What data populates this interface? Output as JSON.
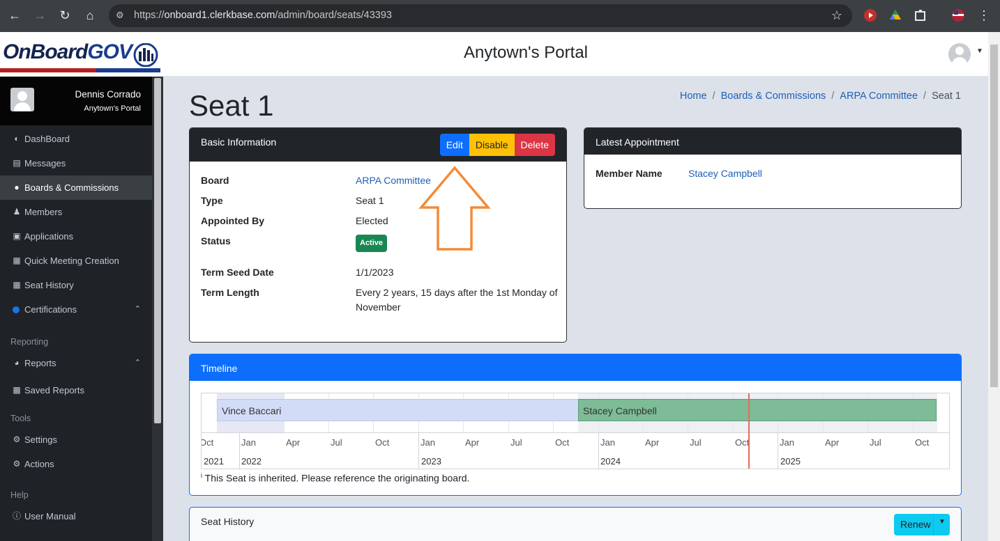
{
  "browser": {
    "url_prefix": "https://",
    "url_host": "onboard1.clerkbase.com",
    "url_path": "/admin/board/seats/43393"
  },
  "logo": {
    "text_main": "OnBoard",
    "text_accent": "GOV"
  },
  "user": {
    "name": "Dennis Corrado",
    "portal": "Anytown's Portal"
  },
  "sidebar": {
    "items": [
      {
        "label": "DashBoard",
        "icon": "tachometer-icon"
      },
      {
        "label": "Messages",
        "icon": "inbox-icon"
      },
      {
        "label": "Boards & Commissions",
        "icon": "users-icon",
        "active": true
      },
      {
        "label": "Members",
        "icon": "user-icon"
      },
      {
        "label": "Applications",
        "icon": "id-card-icon"
      },
      {
        "label": "Quick Meeting Creation",
        "icon": "calendar-plus-icon"
      },
      {
        "label": "Seat History",
        "icon": "calendar-icon"
      },
      {
        "label": "Certifications",
        "icon": "blue-dot-icon"
      }
    ],
    "reporting_header": "Reporting",
    "reporting_items": [
      {
        "label": "Reports",
        "icon": "pie-chart-icon"
      },
      {
        "label": "Saved Reports",
        "icon": "save-icon"
      }
    ],
    "tools_header": "Tools",
    "tools_items": [
      {
        "label": "Settings",
        "icon": "gear-icon"
      },
      {
        "label": "Actions",
        "icon": "gears-icon"
      }
    ],
    "help_header": "Help",
    "help_items": [
      {
        "label": "User Manual",
        "icon": "info-circle-icon"
      }
    ]
  },
  "header": {
    "portal_title": "Anytown's Portal"
  },
  "page": {
    "title": "Seat 1",
    "breadcrumb": [
      "Home",
      "Boards & Commissions",
      "ARPA Committee",
      "Seat 1"
    ]
  },
  "basic_info": {
    "title": "Basic Information",
    "buttons": {
      "edit": "Edit",
      "disable": "Disable",
      "delete": "Delete"
    },
    "rows": {
      "board_label": "Board",
      "board_value": "ARPA Committee",
      "type_label": "Type",
      "type_value": "Seat 1",
      "appointed_label": "Appointed By",
      "appointed_value": "Elected",
      "status_label": "Status",
      "status_value": "Active",
      "seed_label": "Term Seed Date",
      "seed_value": "1/1/2023",
      "length_label": "Term Length",
      "length_value": "Every 2 years, 15 days after the 1st Monday of November"
    }
  },
  "latest_appointment": {
    "title": "Latest Appointment",
    "member_label": "Member Name",
    "member_value": "Stacey Campbell"
  },
  "timeline": {
    "title": "Timeline",
    "members": [
      "Vince Baccari",
      "Stacey Campbell"
    ],
    "months": [
      "Oct",
      "Jan",
      "Apr",
      "Jul",
      "Oct",
      "Jan",
      "Apr",
      "Jul",
      "Oct",
      "Jan",
      "Apr",
      "Jul",
      "Oct",
      "Jan",
      "Apr",
      "Jul",
      "Oct"
    ],
    "years": [
      "2021",
      "2022",
      "2023",
      "2024",
      "2025"
    ],
    "note_marker": "i",
    "note": "This Seat is inherited. Please reference the originating board."
  },
  "seat_history": {
    "title": "Seat History",
    "renew_label": "Renew"
  },
  "colors": {
    "sidebar_bg": "#1f2327",
    "primary": "#0d6efd",
    "warning": "#ffc107",
    "danger": "#dc3545",
    "success": "#198754",
    "info": "#0dcaf0",
    "annotation_arrow": "#f28c38"
  }
}
